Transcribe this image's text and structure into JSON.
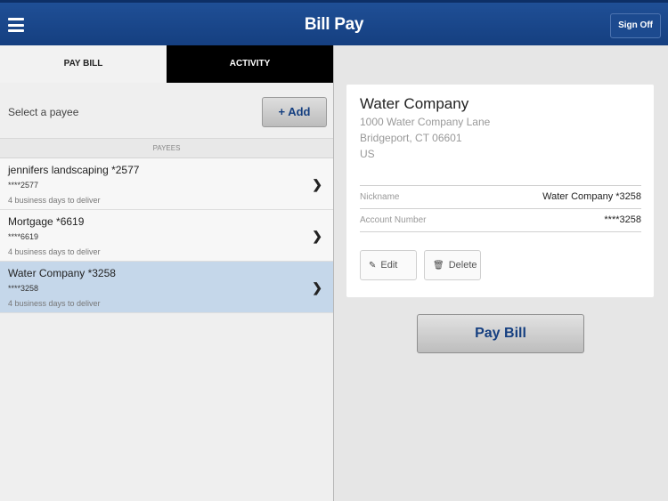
{
  "header": {
    "title": "Bill Pay",
    "signoff_label": "Sign Off"
  },
  "tabs": [
    {
      "label": "PAY BILL"
    },
    {
      "label": "ACTIVITY"
    }
  ],
  "select_payee": {
    "label": "Select a payee",
    "add_label": "+ Add"
  },
  "payees_header": "PAYEES",
  "payees": [
    {
      "name": "jennifers landscaping *2577",
      "account": "****2577",
      "delivery": "4 business days to deliver"
    },
    {
      "name": "Mortgage *6619",
      "account": "****6619",
      "delivery": "4 business days to deliver"
    },
    {
      "name": "Water Company *3258",
      "account": "****3258",
      "delivery": "4 business days to deliver"
    }
  ],
  "detail": {
    "name": "Water Company",
    "address_line1": "1000 Water Company Lane",
    "address_line2": "Bridgeport, CT 06601",
    "address_line3": "US",
    "nickname_label": "Nickname",
    "nickname_value": "Water Company *3258",
    "account_label": "Account Number",
    "account_value": "****3258",
    "edit_label": "Edit",
    "delete_label": "Delete"
  },
  "pay_bill_label": "Pay Bill",
  "icons": {
    "menu": "hamburger-icon",
    "chevron": "chevron-right-icon",
    "edit": "pencil-icon",
    "delete": "trash-icon"
  },
  "colors": {
    "header": "#1a4a8c",
    "selected_row": "#c5d7ea",
    "accent_text": "#153f80"
  }
}
